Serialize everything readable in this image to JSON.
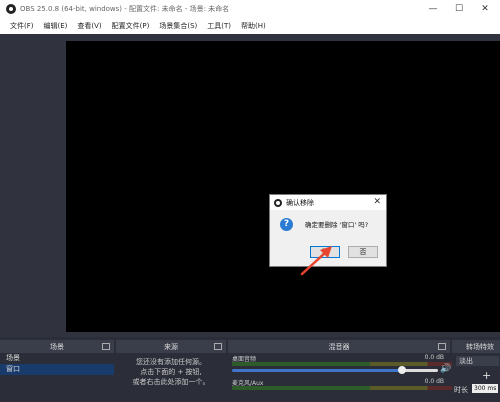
{
  "window": {
    "title": "OBS 25.0.8 (64-bit, windows) - 配置文件: 未命名 - 场景: 未命名",
    "minimize": "—",
    "maximize": "☐",
    "close": "✕"
  },
  "menu": {
    "items": [
      "文件(F)",
      "编辑(E)",
      "查看(V)",
      "配置文件(P)",
      "场景集合(S)",
      "工具(T)",
      "帮助(H)"
    ]
  },
  "docks": {
    "scenes": {
      "title": "场景",
      "items": [
        "场景",
        "窗口"
      ],
      "selected_index": 1
    },
    "sources": {
      "title": "来源",
      "hint_lines": [
        "您还没有添加任何源。",
        "点击下面的 + 按钮,",
        "或者右击此处添加一个。"
      ]
    },
    "mixer": {
      "title": "混音器",
      "channels": [
        {
          "name": "桌面音频",
          "db": "0.0 dB"
        },
        {
          "name": "麦克风/Aux",
          "db": "0.0 dB"
        }
      ]
    },
    "transitions": {
      "title": "转场特效",
      "selected": "淡出",
      "add": "+",
      "duration_label": "时长",
      "duration_value": "300 ms"
    }
  },
  "dialog": {
    "title": "确认移除",
    "message": "确定要删除 '窗口' 吗?",
    "yes": "是",
    "no": "否",
    "close": "✕",
    "question_glyph": "?"
  },
  "colors": {
    "preview": "#000000",
    "accent": "#0078d7",
    "arrow": "#e8452f"
  }
}
